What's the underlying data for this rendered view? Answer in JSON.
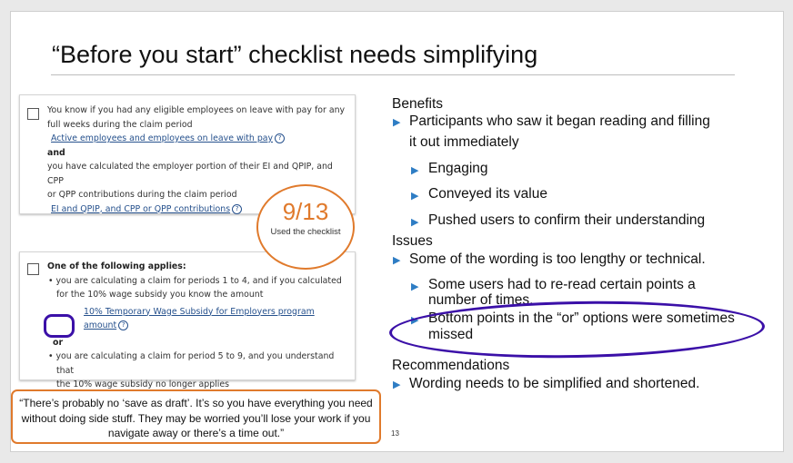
{
  "slide": {
    "title": "“Before you start” checklist needs simplifying",
    "page_number": "13"
  },
  "card1": {
    "line1": "You know if you had any eligible employees on leave with pay for any",
    "line2": "full weeks during the claim period",
    "link1": "Active employees and employees on leave with pay",
    "and": "and",
    "line3": "you have calculated the employer portion of their EI and QPIP, and CPP",
    "line4": "or QPP contributions during the claim period",
    "link2": "EI and QPIP, and CPP or QPP contributions",
    "help_glyph": "?"
  },
  "card2": {
    "heading": "One of the following applies:",
    "b1_line1": "• you are calculating a claim for periods 1 to 4, and if you calculated",
    "b1_line2": "for the 10% wage subsidy you know the amount",
    "link": "10% Temporary Wage Subsidy for Employers program amount",
    "or": "or",
    "b2_line1": "• you are calculating a claim for period 5 to 9, and you understand that",
    "b2_line2": "the 10% wage subsidy no longer applies",
    "help_glyph": "?"
  },
  "badge": {
    "value": "9/13",
    "caption": "Used the checklist"
  },
  "quote": "“There’s probably no ‘save as draft’. It’s so you have everything you need without doing side stuff. They may be worried you’ll lose your work if you navigate away or there’s a time out.”",
  "findings": {
    "benefits_heading": "Benefits",
    "benefit_main_1": "Participants who saw it began reading and filling",
    "benefit_main_2": "it out immediately",
    "benefit_sub_1": "Engaging",
    "benefit_sub_2": "Conveyed its value",
    "benefit_sub_3": "Pushed users to confirm their understanding",
    "issues_heading": "Issues",
    "issue_main": "Some of the wording is too lengthy or technical.",
    "issue_sub_1a": "Some users had to re-read certain points a",
    "issue_sub_1b": "number of times.",
    "issue_sub_2a": "Bottom points in the “or” options were sometimes",
    "issue_sub_2b": "missed",
    "recommendations_heading": "Recommendations",
    "recommendation_main": "Wording needs to be simplified and shortened."
  },
  "colors": {
    "accent_orange": "#e07a2c",
    "annotation_purple": "#3b10a8",
    "bullet_blue": "#2e7dc4",
    "link_blue": "#26518d"
  },
  "icons": {
    "bullet": "triangle-right-icon",
    "help": "help-circle-icon",
    "checkbox": "checkbox-icon"
  }
}
